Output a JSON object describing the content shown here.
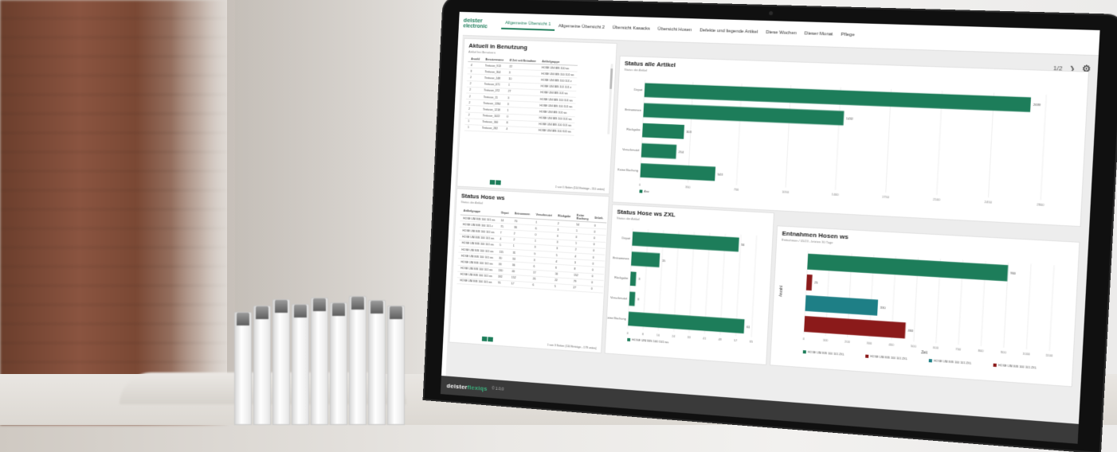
{
  "app": {
    "logo_line1": "deister",
    "logo_line2": "electronic",
    "tabs": [
      {
        "label": "Allgemeine Übersicht 1",
        "active": true
      },
      {
        "label": "Allgemeine Übersicht 2",
        "active": false
      },
      {
        "label": "Übersicht Kasacks",
        "active": false
      },
      {
        "label": "Übersicht Hosen",
        "active": false
      },
      {
        "label": "Defekte und liegende Artikel",
        "active": false
      },
      {
        "label": "Diese Wochen",
        "active": false
      },
      {
        "label": "Dieser Monat",
        "active": false
      },
      {
        "label": "Pflege",
        "active": false
      }
    ],
    "page_indicator": "1/2",
    "accent_color": "#1d7d5a",
    "footer_brand_a": "deister",
    "footer_brand_b": "flexiqs",
    "footer_version": "© 1.0.0"
  },
  "panel_usage": {
    "title": "Aktuell in Benutzung",
    "subtitle": "Artikel bei Benutzern",
    "columns": [
      "Anzahl",
      "Benutzername",
      "Ø Zeit seit Entnahme",
      "Artikelgruppe"
    ],
    "rows": [
      [
        "4",
        "Testuser_913",
        "22",
        "HOSE UNI BIS 100 ws"
      ],
      [
        "3",
        "Testuser_304",
        "3",
        "HOSE UNI BIS 100 101 ws"
      ],
      [
        "2",
        "Testuser_248",
        "10",
        "HOSE UNI BIS 100 101 z"
      ],
      [
        "2",
        "Testuser_671",
        "1",
        "HOSE UNI BIS 101 101 z"
      ],
      [
        "2",
        "Testuser_372",
        "27",
        "HOSE UNI BIS 101 ws"
      ],
      [
        "2",
        "Testuser_11",
        "3",
        "HOSE UNI BIS 100 101 ws"
      ],
      [
        "2",
        "Testuser_1284",
        "3",
        "HOSE UNI BIS 100 101 ws"
      ],
      [
        "2",
        "Testuser_1218",
        "1",
        "HOSE UNI BIS 101 ws"
      ],
      [
        "2",
        "Testuser_1022",
        "0",
        "HOSE UNI BIS 100 101 ws"
      ],
      [
        "1",
        "Testuser_160",
        "8",
        "HOSE UNI BIS 100 101 ws"
      ],
      [
        "1",
        "Testuser_282",
        "4",
        "HOSE UNI BIS 100 101 ws"
      ]
    ],
    "pager_info": "1 von 5 Seiten (114 Einträge - 110 unten)"
  },
  "panel_status_hose": {
    "title": "Status Hose ws",
    "subtitle": "Status der Artikel",
    "columns": [
      "Artikelgruppe",
      "Depot",
      "Entnommen",
      "Verschmutzt",
      "Rückgabe",
      "Keine Buchung",
      "Unbek."
    ],
    "rows": [
      [
        "HOSE UNI BIS 100 101 ws",
        "14",
        "70",
        "1",
        "2",
        "54",
        "0"
      ],
      [
        "HOSE UNI BIS 100 101 z",
        "75",
        "36",
        "6",
        "3",
        "1",
        "0"
      ],
      [
        "HOSE UNI BIS 100 101 ws",
        "7",
        "2",
        "0",
        "0",
        "0",
        "0"
      ],
      [
        "HOSE UNI BIS 100 101 ws",
        "4",
        "2",
        "1",
        "3",
        "1",
        "0"
      ],
      [
        "HOSE UNI BIS 100 101 ws",
        "5",
        "1",
        "3",
        "3",
        "2",
        "0"
      ],
      [
        "HOSE UNI BIS 100 101 ws",
        "115",
        "31",
        "9",
        "5",
        "4",
        "0"
      ],
      [
        "HOSE UNI BIS 100 101 ws",
        "30",
        "34",
        "3",
        "4",
        "3",
        "0"
      ],
      [
        "HOSE UNI BIS 100 101 ws",
        "33",
        "36",
        "6",
        "6",
        "8",
        "0"
      ],
      [
        "HOSE UNI BIS 100 101 ws",
        "130",
        "40",
        "17",
        "16",
        "152",
        "0"
      ],
      [
        "HOSE UNI BIS 100 101 ws",
        "182",
        "152",
        "26",
        "22",
        "79",
        "0"
      ],
      [
        "HOSE UNI BIS 100 101 ws",
        "76",
        "17",
        "6",
        "5",
        "27",
        "0"
      ]
    ],
    "pager_info": "1 von 3 Seiten (110 Einträge - 178 unten)"
  },
  "chart_data": [
    {
      "type": "bar",
      "orientation": "horizontal",
      "title": "Status alle Artikel",
      "subtitle": "Status der Artikel",
      "categories": [
        "Depot",
        "Entnommen",
        "Rückgabe",
        "Verschmutzt",
        "Keine Buchung"
      ],
      "values": [
        2699,
        1432,
        303,
        254,
        543
      ],
      "xlim": [
        0,
        2800
      ],
      "legend": [
        "Anz"
      ],
      "color": "#1d7d5a"
    },
    {
      "type": "bar",
      "orientation": "horizontal",
      "title": "Status Hose ws ZXL",
      "subtitle": "Status der Artikel",
      "categories": [
        "Depot",
        "Entnommen",
        "Rückgabe",
        "Verschmutzt",
        "Keine Buchung"
      ],
      "values": [
        56,
        15,
        3,
        3,
        61
      ],
      "xlim": [
        0,
        65
      ],
      "legend": [
        "HOSE UNI BIS 100 101 ws"
      ],
      "color": "#1d7d5a"
    },
    {
      "type": "bar",
      "orientation": "horizontal",
      "title": "Entnahmen Hosen ws",
      "subtitle": "Entnahmen / 05/23 - letzten 30 Tage",
      "categories": [
        "",
        "",
        "",
        ""
      ],
      "series": [
        {
          "name": "HOSE UNI BIS 100 101 ZXL",
          "color": "#1d7d5a",
          "values": [
            900,
            0,
            0,
            0
          ]
        },
        {
          "name": "HOSE UNI BIS 100 101 ZXL",
          "color": "#8b1a1a",
          "values": [
            0,
            25,
            0,
            0
          ]
        },
        {
          "name": "HOSE UNI BIS 100 101 ZXL",
          "color": "#1e7f86",
          "values": [
            0,
            0,
            330,
            0
          ]
        },
        {
          "name": "HOSE UNI BIS 100 101 ZXL",
          "color": "#8b1a1a",
          "values": [
            0,
            0,
            0,
            460
          ]
        }
      ],
      "xlabel": "Zeit",
      "ylabel": "Anzahl",
      "xlim": [
        0,
        1100
      ]
    }
  ]
}
